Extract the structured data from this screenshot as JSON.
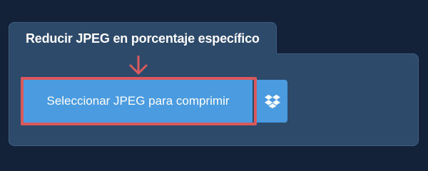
{
  "panel": {
    "title": "Reducir JPEG en porcentaje específico"
  },
  "upload": {
    "select_label": "Seleccionar JPEG para comprimir",
    "dropbox_icon": "dropbox-icon",
    "highlight_icon": "arrow-down-icon"
  },
  "colors": {
    "background": "#132238",
    "panel": "#2e4a6b",
    "button": "#4a9be0",
    "highlight": "#d9595c"
  }
}
